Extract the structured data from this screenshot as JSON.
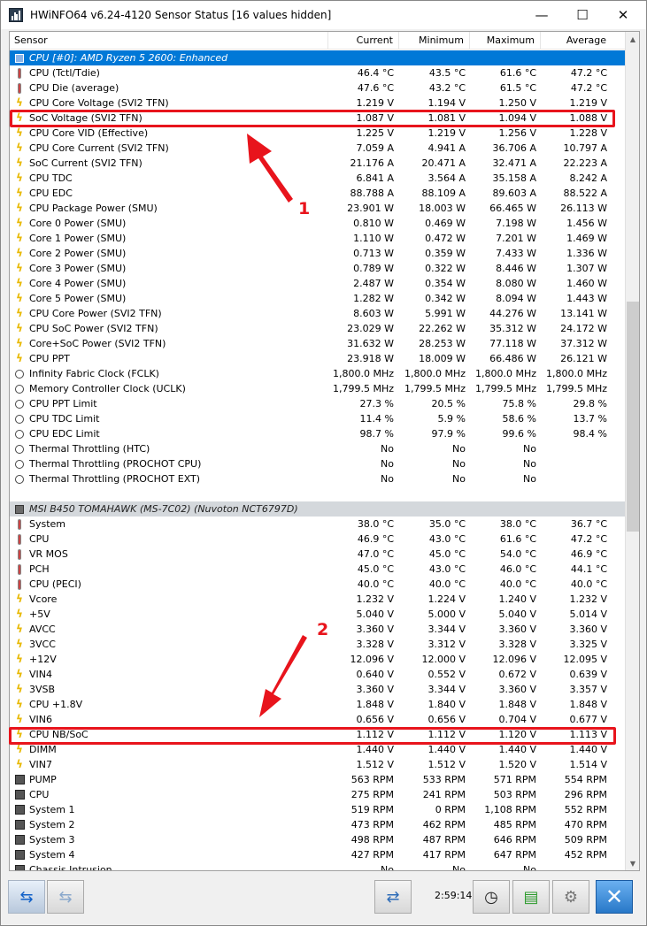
{
  "window": {
    "title": "HWiNFO64 v6.24-4120 Sensor Status [16 values hidden]",
    "minimize_glyph": "—",
    "maximize_glyph": "☐",
    "close_glyph": "✕"
  },
  "columns": {
    "sensor": "Sensor",
    "current": "Current",
    "minimum": "Minimum",
    "maximum": "Maximum",
    "average": "Average"
  },
  "rows": [
    {
      "type": "group",
      "selected": true,
      "name": "CPU [#0]: AMD Ryzen 5 2600: Enhanced"
    },
    {
      "icon": "thermometer-icon",
      "name": "CPU (Tctl/Tdie)",
      "cur": "46.4 °C",
      "min": "43.5 °C",
      "max": "61.6 °C",
      "avg": "47.2 °C"
    },
    {
      "icon": "thermometer-icon",
      "name": "CPU Die (average)",
      "cur": "47.6 °C",
      "min": "43.2 °C",
      "max": "61.5 °C",
      "avg": "47.2 °C"
    },
    {
      "icon": "bolt-icon",
      "name": "CPU Core Voltage (SVI2 TFN)",
      "cur": "1.219 V",
      "min": "1.194 V",
      "max": "1.250 V",
      "avg": "1.219 V"
    },
    {
      "icon": "bolt-icon",
      "name": "SoC Voltage (SVI2 TFN)",
      "cur": "1.087 V",
      "min": "1.081 V",
      "max": "1.094 V",
      "avg": "1.088 V"
    },
    {
      "icon": "bolt-icon",
      "name": "CPU Core VID (Effective)",
      "cur": "1.225 V",
      "min": "1.219 V",
      "max": "1.256 V",
      "avg": "1.228 V"
    },
    {
      "icon": "bolt-icon",
      "name": "CPU Core Current (SVI2 TFN)",
      "cur": "7.059 A",
      "min": "4.941 A",
      "max": "36.706 A",
      "avg": "10.797 A"
    },
    {
      "icon": "bolt-icon",
      "name": "SoC Current (SVI2 TFN)",
      "cur": "21.176 A",
      "min": "20.471 A",
      "max": "32.471 A",
      "avg": "22.223 A"
    },
    {
      "icon": "bolt-icon",
      "name": "CPU TDC",
      "cur": "6.841 A",
      "min": "3.564 A",
      "max": "35.158 A",
      "avg": "8.242 A"
    },
    {
      "icon": "bolt-icon",
      "name": "CPU EDC",
      "cur": "88.788 A",
      "min": "88.109 A",
      "max": "89.603 A",
      "avg": "88.522 A"
    },
    {
      "icon": "bolt-icon",
      "name": "CPU Package Power (SMU)",
      "cur": "23.901 W",
      "min": "18.003 W",
      "max": "66.465 W",
      "avg": "26.113 W"
    },
    {
      "icon": "bolt-icon",
      "name": "Core 0 Power (SMU)",
      "cur": "0.810 W",
      "min": "0.469 W",
      "max": "7.198 W",
      "avg": "1.456 W"
    },
    {
      "icon": "bolt-icon",
      "name": "Core 1 Power (SMU)",
      "cur": "1.110 W",
      "min": "0.472 W",
      "max": "7.201 W",
      "avg": "1.469 W"
    },
    {
      "icon": "bolt-icon",
      "name": "Core 2 Power (SMU)",
      "cur": "0.713 W",
      "min": "0.359 W",
      "max": "7.433 W",
      "avg": "1.336 W"
    },
    {
      "icon": "bolt-icon",
      "name": "Core 3 Power (SMU)",
      "cur": "0.789 W",
      "min": "0.322 W",
      "max": "8.446 W",
      "avg": "1.307 W"
    },
    {
      "icon": "bolt-icon",
      "name": "Core 4 Power (SMU)",
      "cur": "2.487 W",
      "min": "0.354 W",
      "max": "8.080 W",
      "avg": "1.460 W"
    },
    {
      "icon": "bolt-icon",
      "name": "Core 5 Power (SMU)",
      "cur": "1.282 W",
      "min": "0.342 W",
      "max": "8.094 W",
      "avg": "1.443 W"
    },
    {
      "icon": "bolt-icon",
      "name": "CPU Core Power (SVI2 TFN)",
      "cur": "8.603 W",
      "min": "5.991 W",
      "max": "44.276 W",
      "avg": "13.141 W"
    },
    {
      "icon": "bolt-icon",
      "name": "CPU SoC Power (SVI2 TFN)",
      "cur": "23.029 W",
      "min": "22.262 W",
      "max": "35.312 W",
      "avg": "24.172 W"
    },
    {
      "icon": "bolt-icon",
      "name": "Core+SoC Power (SVI2 TFN)",
      "cur": "31.632 W",
      "min": "28.253 W",
      "max": "77.118 W",
      "avg": "37.312 W"
    },
    {
      "icon": "bolt-icon",
      "name": "CPU PPT",
      "cur": "23.918 W",
      "min": "18.009 W",
      "max": "66.486 W",
      "avg": "26.121 W"
    },
    {
      "icon": "clock-icon",
      "name": "Infinity Fabric Clock (FCLK)",
      "cur": "1,800.0 MHz",
      "min": "1,800.0 MHz",
      "max": "1,800.0 MHz",
      "avg": "1,800.0 MHz"
    },
    {
      "icon": "clock-icon",
      "name": "Memory Controller Clock (UCLK)",
      "cur": "1,799.5 MHz",
      "min": "1,799.5 MHz",
      "max": "1,799.5 MHz",
      "avg": "1,799.5 MHz"
    },
    {
      "icon": "clock-icon",
      "name": "CPU PPT Limit",
      "cur": "27.3 %",
      "min": "20.5 %",
      "max": "75.8 %",
      "avg": "29.8 %"
    },
    {
      "icon": "clock-icon",
      "name": "CPU TDC Limit",
      "cur": "11.4 %",
      "min": "5.9 %",
      "max": "58.6 %",
      "avg": "13.7 %"
    },
    {
      "icon": "clock-icon",
      "name": "CPU EDC Limit",
      "cur": "98.7 %",
      "min": "97.9 %",
      "max": "99.6 %",
      "avg": "98.4 %"
    },
    {
      "icon": "clock-icon",
      "name": "Thermal Throttling (HTC)",
      "cur": "No",
      "min": "No",
      "max": "No",
      "avg": ""
    },
    {
      "icon": "clock-icon",
      "name": "Thermal Throttling (PROCHOT CPU)",
      "cur": "No",
      "min": "No",
      "max": "No",
      "avg": ""
    },
    {
      "icon": "clock-icon",
      "name": "Thermal Throttling (PROCHOT EXT)",
      "cur": "No",
      "min": "No",
      "max": "No",
      "avg": ""
    },
    {
      "type": "blank"
    },
    {
      "type": "group",
      "selected": false,
      "name": "MSI B450 TOMAHAWK (MS-7C02) (Nuvoton NCT6797D)"
    },
    {
      "icon": "thermometer-icon",
      "name": "System",
      "cur": "38.0 °C",
      "min": "35.0 °C",
      "max": "38.0 °C",
      "avg": "36.7 °C"
    },
    {
      "icon": "thermometer-icon",
      "name": "CPU",
      "cur": "46.9 °C",
      "min": "43.0 °C",
      "max": "61.6 °C",
      "avg": "47.2 °C"
    },
    {
      "icon": "thermometer-icon",
      "name": "VR MOS",
      "cur": "47.0 °C",
      "min": "45.0 °C",
      "max": "54.0 °C",
      "avg": "46.9 °C"
    },
    {
      "icon": "thermometer-icon",
      "name": "PCH",
      "cur": "45.0 °C",
      "min": "43.0 °C",
      "max": "46.0 °C",
      "avg": "44.1 °C"
    },
    {
      "icon": "thermometer-icon",
      "name": "CPU (PECI)",
      "cur": "40.0 °C",
      "min": "40.0 °C",
      "max": "40.0 °C",
      "avg": "40.0 °C"
    },
    {
      "icon": "bolt-icon",
      "name": "Vcore",
      "cur": "1.232 V",
      "min": "1.224 V",
      "max": "1.240 V",
      "avg": "1.232 V"
    },
    {
      "icon": "bolt-icon",
      "name": "+5V",
      "cur": "5.040 V",
      "min": "5.000 V",
      "max": "5.040 V",
      "avg": "5.014 V"
    },
    {
      "icon": "bolt-icon",
      "name": "AVCC",
      "cur": "3.360 V",
      "min": "3.344 V",
      "max": "3.360 V",
      "avg": "3.360 V"
    },
    {
      "icon": "bolt-icon",
      "name": "3VCC",
      "cur": "3.328 V",
      "min": "3.312 V",
      "max": "3.328 V",
      "avg": "3.325 V"
    },
    {
      "icon": "bolt-icon",
      "name": "+12V",
      "cur": "12.096 V",
      "min": "12.000 V",
      "max": "12.096 V",
      "avg": "12.095 V"
    },
    {
      "icon": "bolt-icon",
      "name": "VIN4",
      "cur": "0.640 V",
      "min": "0.552 V",
      "max": "0.672 V",
      "avg": "0.639 V"
    },
    {
      "icon": "bolt-icon",
      "name": "3VSB",
      "cur": "3.360 V",
      "min": "3.344 V",
      "max": "3.360 V",
      "avg": "3.357 V"
    },
    {
      "icon": "bolt-icon",
      "name": "CPU +1.8V",
      "cur": "1.848 V",
      "min": "1.840 V",
      "max": "1.848 V",
      "avg": "1.848 V"
    },
    {
      "icon": "bolt-icon",
      "name": "VIN6",
      "cur": "0.656 V",
      "min": "0.656 V",
      "max": "0.704 V",
      "avg": "0.677 V"
    },
    {
      "icon": "bolt-icon",
      "name": "CPU NB/SoC",
      "cur": "1.112 V",
      "min": "1.112 V",
      "max": "1.120 V",
      "avg": "1.113 V"
    },
    {
      "icon": "bolt-icon",
      "name": "DIMM",
      "cur": "1.440 V",
      "min": "1.440 V",
      "max": "1.440 V",
      "avg": "1.440 V"
    },
    {
      "icon": "bolt-icon",
      "name": "VIN7",
      "cur": "1.512 V",
      "min": "1.512 V",
      "max": "1.520 V",
      "avg": "1.514 V"
    },
    {
      "icon": "fan-icon",
      "name": "PUMP",
      "cur": "563 RPM",
      "min": "533 RPM",
      "max": "571 RPM",
      "avg": "554 RPM"
    },
    {
      "icon": "fan-icon",
      "name": "CPU",
      "cur": "275 RPM",
      "min": "241 RPM",
      "max": "503 RPM",
      "avg": "296 RPM"
    },
    {
      "icon": "fan-icon",
      "name": "System 1",
      "cur": "519 RPM",
      "min": "0 RPM",
      "max": "1,108 RPM",
      "avg": "552 RPM"
    },
    {
      "icon": "fan-icon",
      "name": "System 2",
      "cur": "473 RPM",
      "min": "462 RPM",
      "max": "485 RPM",
      "avg": "470 RPM"
    },
    {
      "icon": "fan-icon",
      "name": "System 3",
      "cur": "498 RPM",
      "min": "487 RPM",
      "max": "646 RPM",
      "avg": "509 RPM"
    },
    {
      "icon": "fan-icon",
      "name": "System 4",
      "cur": "427 RPM",
      "min": "417 RPM",
      "max": "647 RPM",
      "avg": "452 RPM"
    },
    {
      "icon": "fan-icon",
      "name": "Chassis Intrusion",
      "cur": "No",
      "min": "No",
      "max": "No",
      "avg": ""
    }
  ],
  "annotations": {
    "label_1": "1",
    "label_2": "2",
    "highlight_color": "#e8141c"
  },
  "toolbar": {
    "elapsed_time": "2:59:14",
    "nav_left_icon": "double-arrow-icon",
    "nav_right_icon": "double-arrow-icon",
    "network_icon": "network-icon",
    "clock_icon": "clock-icon",
    "report_icon": "report-add-icon",
    "settings_icon": "gear-icon",
    "close_icon": "close-icon"
  },
  "colors": {
    "selected_group": "#0078d7",
    "group": "#d4d8dc",
    "close_button": "#2878c8"
  }
}
